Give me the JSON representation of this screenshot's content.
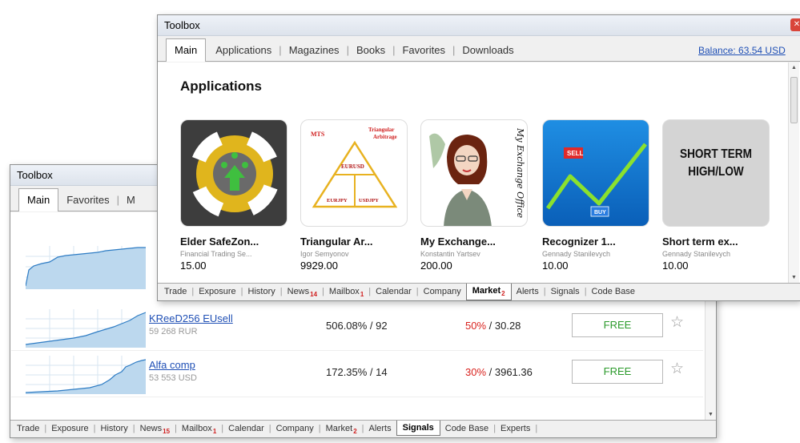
{
  "back_window": {
    "title": "Toolbox",
    "top_tabs": [
      "Main",
      "Favorites",
      "M"
    ],
    "rows": [
      {
        "name": "KReeD256 EUsell",
        "subscribers": "59 268 RUR",
        "gain": "506.08% / 92",
        "dd_pct": "50%",
        "dd_rest": " / 30.28",
        "price": "FREE"
      },
      {
        "name": "Alfa comp",
        "subscribers": "53 553 USD",
        "gain": "172.35% / 14",
        "dd_pct": "30%",
        "dd_rest": " / 3961.36",
        "price": "FREE"
      }
    ],
    "bottom_tabs": [
      {
        "label": "Trade",
        "count": ""
      },
      {
        "label": "Exposure",
        "count": ""
      },
      {
        "label": "History",
        "count": ""
      },
      {
        "label": "News",
        "count": "15"
      },
      {
        "label": "Mailbox",
        "count": "1"
      },
      {
        "label": "Calendar",
        "count": ""
      },
      {
        "label": "Company",
        "count": ""
      },
      {
        "label": "Market",
        "count": "2"
      },
      {
        "label": "Alerts",
        "count": ""
      },
      {
        "label": "Signals",
        "count": ""
      },
      {
        "label": "Code Base",
        "count": ""
      },
      {
        "label": "Experts",
        "count": ""
      }
    ],
    "active_bottom_tab": "Signals"
  },
  "front_window": {
    "title": "Toolbox",
    "top_tabs": [
      "Main",
      "Applications",
      "Magazines",
      "Books",
      "Favorites",
      "Downloads"
    ],
    "balance": "Balance: 63.54 USD",
    "section_title": "Applications",
    "apps": [
      {
        "title": "Elder SafeZon...",
        "author": "Financial Trading Se...",
        "price": "15.00",
        "icon": "lifebuoy-arrow-icon"
      },
      {
        "title": "Triangular Ar...",
        "author": "Igor Semyonov",
        "price": "9929.00",
        "icon": "triangle-arbitrage-icon",
        "img_labels": {
          "mts": "MTS",
          "title": "Triangular Arbitrage",
          "top": "EURUSD",
          "left": "EURJPY",
          "right": "USDJPY"
        }
      },
      {
        "title": "My Exchange...",
        "author": "Konstantin Yartsev",
        "price": "200.00",
        "icon": "woman-office-icon",
        "img_text": "My Exchange Office"
      },
      {
        "title": "Recognizer 1...",
        "author": "Gennady Stanilevych",
        "price": "10.00",
        "icon": "sell-buy-chart-icon",
        "img_labels": {
          "sell": "SELL",
          "buy": "BUY"
        }
      },
      {
        "title": "Short term ex...",
        "author": "Gennady Stanilevych",
        "price": "10.00",
        "icon": "short-term-text-icon",
        "img_text_line1": "SHORT TERM",
        "img_text_line2": "HIGH/LOW"
      }
    ],
    "bottom_tabs": [
      {
        "label": "Trade",
        "count": ""
      },
      {
        "label": "Exposure",
        "count": ""
      },
      {
        "label": "History",
        "count": ""
      },
      {
        "label": "News",
        "count": "14"
      },
      {
        "label": "Mailbox",
        "count": "1"
      },
      {
        "label": "Calendar",
        "count": ""
      },
      {
        "label": "Company",
        "count": ""
      },
      {
        "label": "Market",
        "count": "2"
      },
      {
        "label": "Alerts",
        "count": ""
      },
      {
        "label": "Signals",
        "count": ""
      },
      {
        "label": "Code Base",
        "count": ""
      }
    ],
    "active_bottom_tab": "Market"
  },
  "colors": {
    "accent_blue": "#1f4fb5",
    "count_red": "#d01f1f",
    "free_green": "#2b9a2b"
  }
}
